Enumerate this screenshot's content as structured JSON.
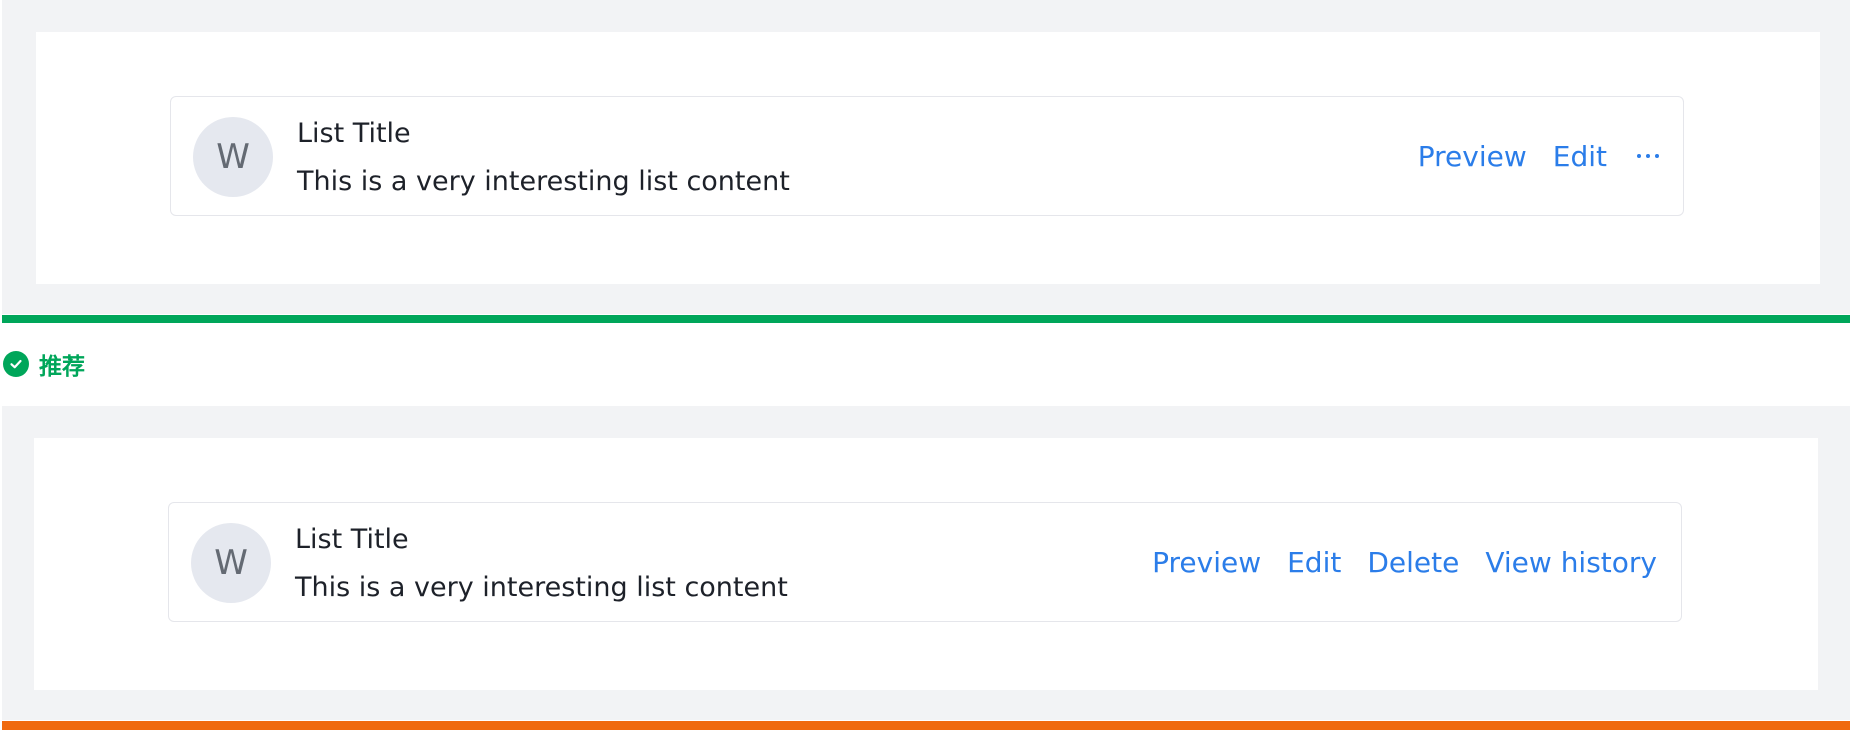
{
  "examples": [
    {
      "avatar_letter": "W",
      "title": "List Title",
      "description": "This is a very interesting list content",
      "actions": [
        "Preview",
        "Edit"
      ],
      "has_more_menu": true
    },
    {
      "avatar_letter": "W",
      "title": "List Title",
      "description": "This is a very interesting list content",
      "actions": [
        "Preview",
        "Edit",
        "Delete",
        "View history"
      ],
      "has_more_menu": false
    }
  ],
  "recommendation": {
    "label": "推荐",
    "icon": "check-circle-icon",
    "color": "#00a65a"
  },
  "colors": {
    "action_link": "#2b7de9",
    "good_bar": "#00a65a",
    "bad_bar": "#f06a0f"
  }
}
